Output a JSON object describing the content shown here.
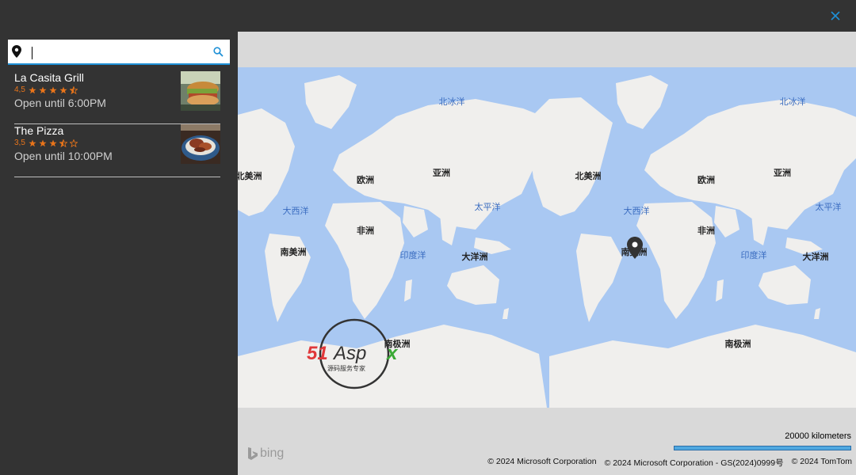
{
  "window": {
    "close_icon": "close-icon",
    "accent": "#1e90d6"
  },
  "search": {
    "value": "",
    "placeholder": "",
    "pin_icon": "map-pin-icon",
    "search_icon": "search-icon"
  },
  "results": [
    {
      "name": "La Casita Grill",
      "rating": "4,5",
      "stars": 4.5,
      "hours": "Open until 6:00PM",
      "thumb_icon": "food-photo"
    },
    {
      "name": "The Pizza",
      "rating": "3,5",
      "stars": 3.5,
      "hours": "Open until 10:00PM",
      "thumb_icon": "food-photo"
    }
  ],
  "map": {
    "labels": {
      "arctic_1": "北冰洋",
      "arctic_2": "北冰洋",
      "north_america_1": "北美洲",
      "north_america_2": "北美洲",
      "europe_1": "欧洲",
      "europe_2": "欧洲",
      "asia_1": "亚洲",
      "asia_2": "亚洲",
      "atlantic_1": "大西洋",
      "atlantic_2": "大西洋",
      "pacific_1": "太平洋",
      "pacific_2": "太平洋",
      "africa_1": "非洲",
      "africa_2": "非洲",
      "south_america_1": "南美洲",
      "south_america_2": "南美洲",
      "indian_1": "印度洋",
      "indian_2": "印度洋",
      "oceania_1": "大洋洲",
      "oceania_2": "大洋洲",
      "antarctica_1": "南极洲",
      "antarctica_2": "南极洲"
    },
    "watermark": {
      "brand": "51Aspx",
      "tagline": "源码服务专家"
    },
    "bing": "bing",
    "scale": "20000 kilometers",
    "copyrights": [
      "© 2024 Microsoft Corporation",
      "© 2024 Microsoft Corporation - GS(2024)0999号",
      "© 2024 TomTom"
    ],
    "colors": {
      "water": "#a9c8f2",
      "land": "#f0efed",
      "label_ocean": "#3a6cc0"
    }
  }
}
